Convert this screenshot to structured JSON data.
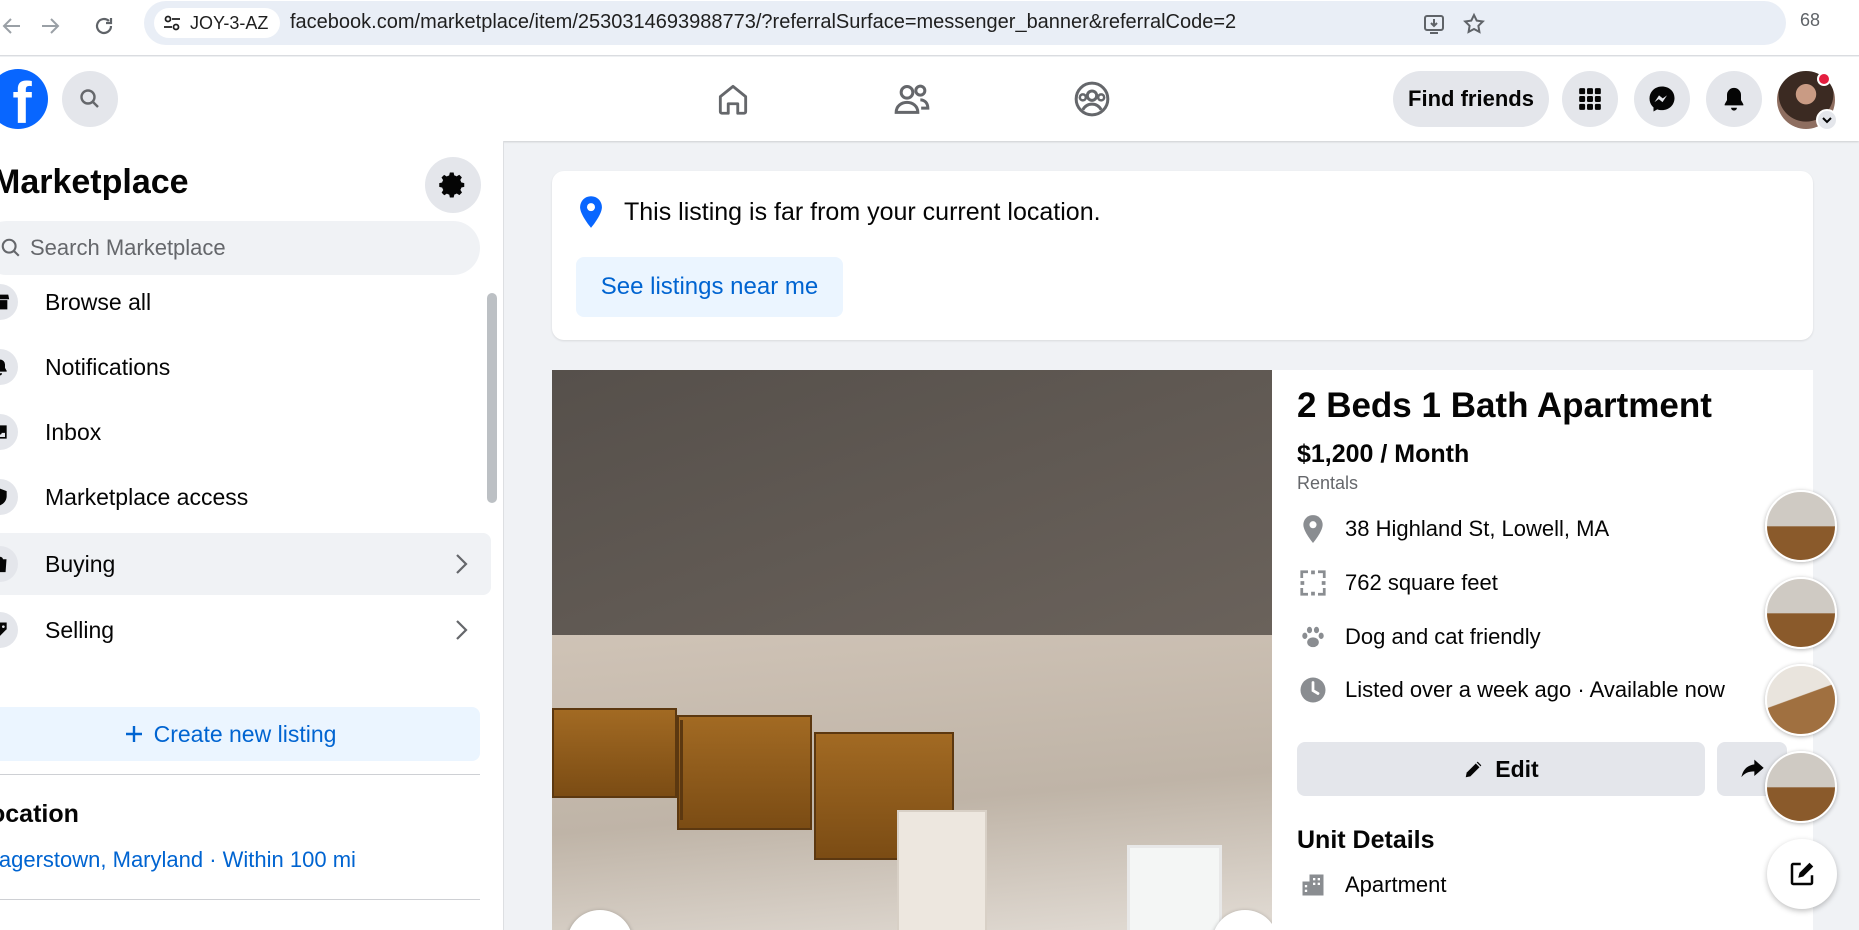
{
  "browser": {
    "site_chip_label": "JOY-3-AZ",
    "url": "facebook.com/marketplace/item/2530314693988773/?referralSurface=messenger_banner&referralCode=2",
    "extensions_count": "68"
  },
  "topnav": {
    "logo_letter": "f",
    "find_friends_label": "Find friends"
  },
  "sidebar": {
    "title": "Marketplace",
    "search_placeholder": "Search Marketplace",
    "items": [
      {
        "label": "Browse all"
      },
      {
        "label": "Notifications"
      },
      {
        "label": "Inbox"
      },
      {
        "label": "Marketplace access"
      },
      {
        "label": "Buying"
      },
      {
        "label": "Selling"
      }
    ],
    "create_listing_label": "Create new listing",
    "location_heading": "ocation",
    "location_value": "lagerstown, Maryland · Within 100 mi"
  },
  "banner": {
    "message": "This listing is far from your current location.",
    "button_label": "See listings near me"
  },
  "listing": {
    "title": "2 Beds 1 Bath Apartment",
    "price": "$1,200 / Month",
    "category": "Rentals",
    "attributes": [
      {
        "icon": "location-pin-icon",
        "text": "38 Highland St, Lowell, MA"
      },
      {
        "icon": "square-feet-icon",
        "text": "762 square feet"
      },
      {
        "icon": "paw-icon",
        "text": "Dog and cat friendly"
      },
      {
        "icon": "clock-icon",
        "text": "Listed over a week ago · Available now"
      }
    ],
    "edit_label": "Edit",
    "unit_details_heading": "Unit Details",
    "unit_type": "Apartment"
  },
  "colors": {
    "brand": "#0866ff",
    "link": "#0064d1",
    "light_blue_bg": "#ebf5ff",
    "grey_button": "#e4e6eb",
    "page_bg": "#f0f2f5"
  }
}
